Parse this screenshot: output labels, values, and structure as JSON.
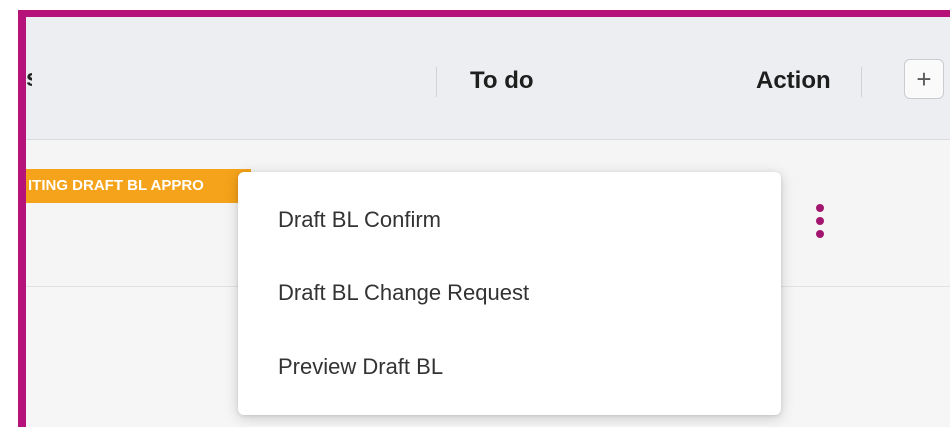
{
  "table": {
    "header": {
      "partial_column_label": "s",
      "todo_label": "To do",
      "action_label": "Action",
      "add_button_label": "+"
    },
    "row": {
      "status_badge": "ITING DRAFT BL APPRO",
      "row_menu_icon": "kebab-vertical-icon"
    }
  },
  "dropdown_menu": {
    "items": [
      {
        "label": "Draft BL Confirm"
      },
      {
        "label": "Draft BL Change Request"
      },
      {
        "label": "Preview Draft BL"
      }
    ]
  },
  "colors": {
    "highlight_border": "#b5127a",
    "status_badge": "#f5a31a",
    "kebab": "#a3166f"
  }
}
